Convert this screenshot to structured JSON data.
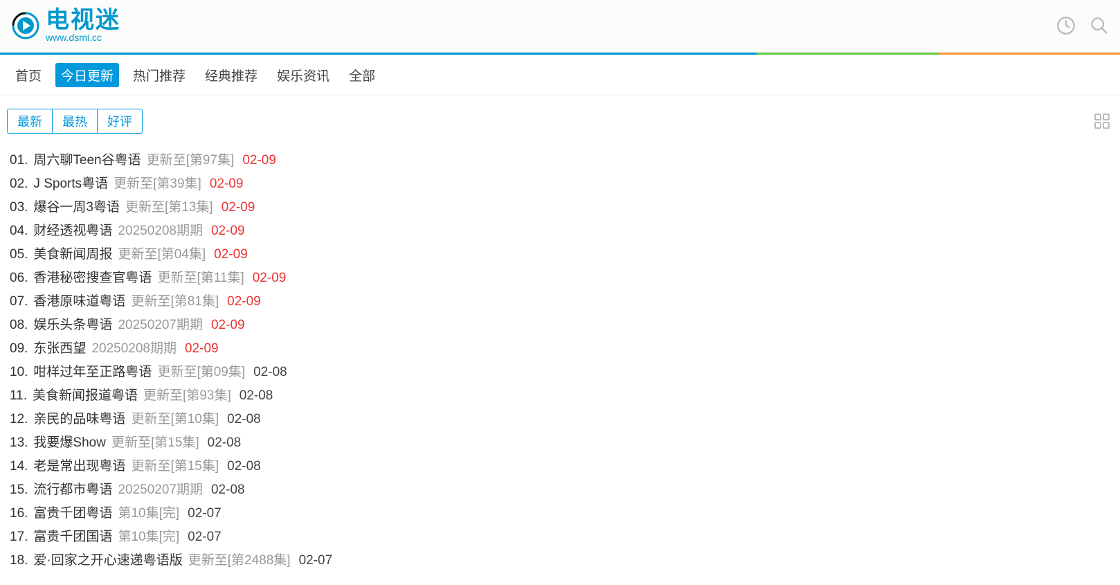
{
  "site": {
    "name": "电视迷",
    "url": "www.dsmi.cc"
  },
  "nav": [
    "首页",
    "今日更新",
    "热门推荐",
    "经典推荐",
    "娱乐资讯",
    "全部"
  ],
  "nav_active_index": 1,
  "filters": [
    "最新",
    "最热",
    "好评"
  ],
  "items": [
    {
      "num": "01.",
      "title": "周六聊Teen谷粤语",
      "status": "更新至[第97集]",
      "date": "02-09",
      "hot": true
    },
    {
      "num": "02.",
      "title": "J Sports粤语",
      "status": "更新至[第39集]",
      "date": "02-09",
      "hot": true
    },
    {
      "num": "03.",
      "title": "爆谷一周3粤语",
      "status": "更新至[第13集]",
      "date": "02-09",
      "hot": true
    },
    {
      "num": "04.",
      "title": "财经透视粤语",
      "status": "20250208期期",
      "date": "02-09",
      "hot": true
    },
    {
      "num": "05.",
      "title": "美食新闻周报",
      "status": "更新至[第04集]",
      "date": "02-09",
      "hot": true
    },
    {
      "num": "06.",
      "title": "香港秘密搜查官粤语",
      "status": "更新至[第11集]",
      "date": "02-09",
      "hot": true
    },
    {
      "num": "07.",
      "title": "香港原味道粤语",
      "status": "更新至[第81集]",
      "date": "02-09",
      "hot": true
    },
    {
      "num": "08.",
      "title": "娱乐头条粤语",
      "status": "20250207期期",
      "date": "02-09",
      "hot": true
    },
    {
      "num": "09.",
      "title": "东张西望",
      "status": "20250208期期",
      "date": "02-09",
      "hot": true
    },
    {
      "num": "10.",
      "title": "咁样过年至正路粤语",
      "status": "更新至[第09集]",
      "date": "02-08",
      "hot": false
    },
    {
      "num": "11.",
      "title": "美食新闻报道粤语",
      "status": "更新至[第93集]",
      "date": "02-08",
      "hot": false
    },
    {
      "num": "12.",
      "title": "亲民的品味粤语",
      "status": "更新至[第10集]",
      "date": "02-08",
      "hot": false
    },
    {
      "num": "13.",
      "title": "我要爆Show",
      "status": "更新至[第15集]",
      "date": "02-08",
      "hot": false
    },
    {
      "num": "14.",
      "title": "老是常出现粤语",
      "status": "更新至[第15集]",
      "date": "02-08",
      "hot": false
    },
    {
      "num": "15.",
      "title": "流行都市粤语",
      "status": "20250207期期",
      "date": "02-08",
      "hot": false
    },
    {
      "num": "16.",
      "title": "富贵千团粤语",
      "status": "第10集[完]",
      "date": "02-07",
      "hot": false
    },
    {
      "num": "17.",
      "title": "富贵千团国语",
      "status": "第10集[完]",
      "date": "02-07",
      "hot": false
    },
    {
      "num": "18.",
      "title": "爱·回家之开心速递粤语版",
      "status": "更新至[第2488集]",
      "date": "02-07",
      "hot": false
    }
  ]
}
